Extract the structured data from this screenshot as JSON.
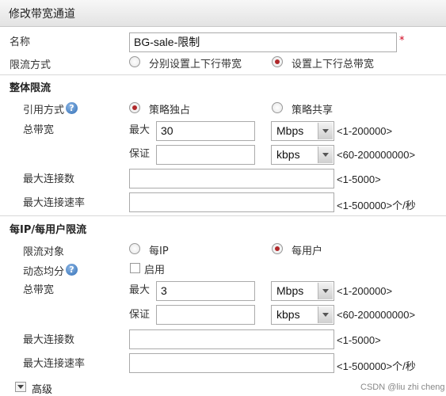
{
  "dialog": {
    "title": "修改带宽通道"
  },
  "basic": {
    "name_label": "名称",
    "name_value": "BG-sale-限制",
    "required_mark": "*",
    "limit_mode_label": "限流方式",
    "limit_mode_options": [
      "分别设置上下行带宽",
      "设置上下行总带宽"
    ],
    "limit_mode_selected": "设置上下行总带宽"
  },
  "overall": {
    "section_title": "整体限流",
    "ref_mode_label": "引用方式",
    "ref_mode_options": [
      "策略独占",
      "策略共享"
    ],
    "ref_mode_selected": "策略独占",
    "total_bw_label": "总带宽",
    "max_label": "最大",
    "max_value": "30",
    "max_unit": "Mbps",
    "max_range": "<1-200000>",
    "guarantee_label": "保证",
    "guarantee_value": "",
    "guarantee_unit": "kbps",
    "guarantee_range": "<60-200000000>",
    "max_conn_label": "最大连接数",
    "max_conn_value": "",
    "max_conn_range": "<1-5000>",
    "max_conn_rate_label": "最大连接速率",
    "max_conn_rate_value": "",
    "max_conn_rate_range": "<1-500000>个/秒"
  },
  "per_ip": {
    "section_title": "每IP/每用户限流",
    "target_label": "限流对象",
    "target_options": [
      "每IP",
      "每用户"
    ],
    "target_selected": "每用户",
    "dynamic_label": "动态均分",
    "dynamic_checkbox_label": "启用",
    "dynamic_enabled": false,
    "total_bw_label": "总带宽",
    "max_label": "最大",
    "max_value": "3",
    "max_unit": "Mbps",
    "max_range": "<1-200000>",
    "guarantee_label": "保证",
    "guarantee_value": "",
    "guarantee_unit": "kbps",
    "guarantee_range": "<60-200000000>",
    "max_conn_label": "最大连接数",
    "max_conn_value": "",
    "max_conn_range": "<1-5000>",
    "max_conn_rate_label": "最大连接速率",
    "max_conn_rate_value": "",
    "max_conn_rate_range": "<1-500000>个/秒"
  },
  "advanced": {
    "label": "高级"
  },
  "icons": {
    "help": "help-icon",
    "expand": "chevron-down-icon"
  },
  "colors": {
    "radio_selected": "#b0282a",
    "required": "#d0021b",
    "help_icon": "#2f6db5"
  },
  "watermark": "CSDN @liu zhi cheng"
}
